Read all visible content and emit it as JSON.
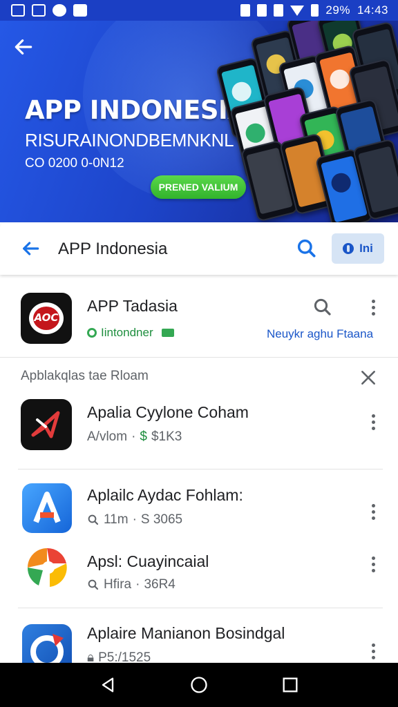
{
  "status_bar": {
    "battery_percent": "29%",
    "time": "14:43"
  },
  "banner": {
    "title": "APP INDONESIA",
    "subtitle": "RISURAINONDBEMNKNL",
    "small_text": "CO 0200 0-0N12",
    "pill_label": "PRENED VALIUM"
  },
  "search": {
    "query": "APP Indonesia",
    "pill_label": "Ini"
  },
  "top_result": {
    "icon_text": "AOC",
    "title": "APP Tadasia",
    "developer": "Iintondner",
    "link": "Neuykr aghu Ftaana"
  },
  "section": {
    "header": "Apblakqlas tae Rloam"
  },
  "items": [
    {
      "title": "Apalia Cyylone Coham",
      "meta_label": "A/vlom",
      "meta_value": "$1K3"
    },
    {
      "title": "Aplailc Aydac Fohlam:",
      "meta_label": "11m",
      "meta_value": "S 3065"
    },
    {
      "title": "Apsl: Cuayincaial",
      "meta_label": "Hfira",
      "meta_value": "36R4"
    },
    {
      "title": "Aplaire Manianon Bosindgal",
      "meta_label": "P5:/1525",
      "meta_value": ""
    }
  ],
  "colors": {
    "banner_blue": "#1d44c9",
    "accent_blue": "#1a73e8",
    "green": "#1e8e3e"
  },
  "icons": [
    "back-arrow",
    "search",
    "more-vertical",
    "close",
    "nav-back",
    "nav-home",
    "nav-recents"
  ]
}
